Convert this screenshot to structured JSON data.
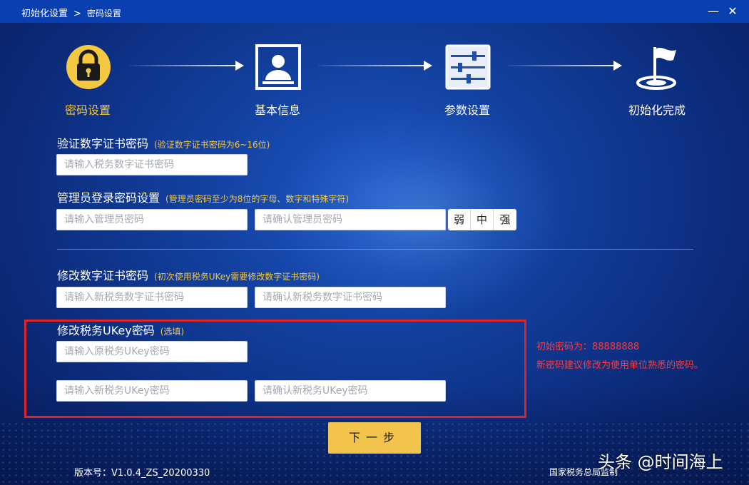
{
  "titlebar": {
    "breadcrumb_root": "初始化设置",
    "breadcrumb_sep": ">",
    "breadcrumb_current": "密码设置",
    "minimize_label": "—",
    "close_label": "✕"
  },
  "steps": [
    {
      "label": "密码设置",
      "icon": "lock-icon",
      "active": true
    },
    {
      "label": "基本信息",
      "icon": "id-card-icon",
      "active": false
    },
    {
      "label": "参数设置",
      "icon": "sliders-icon",
      "active": false
    },
    {
      "label": "初始化完成",
      "icon": "flag-icon",
      "active": false
    }
  ],
  "cert_verify": {
    "title": "验证数字证书密码",
    "hint": "(验证数字证书密码为6~16位)",
    "input_placeholder": "请输入税务数字证书密码",
    "input_value": ""
  },
  "admin_password": {
    "title": "管理员登录密码设置",
    "hint": "(管理员密码至少为8位的字母、数字和特殊字符)",
    "input_placeholder": "请输入管理员密码",
    "confirm_placeholder": "请确认管理员密码",
    "strength": [
      "弱",
      "中",
      "强"
    ]
  },
  "cert_change": {
    "title": "修改数字证书密码",
    "hint": "(初次使用税务UKey需要修改数字证书密码)",
    "new_placeholder": "请输入新税务数字证书密码",
    "confirm_placeholder": "请确认新税务数字证书密码"
  },
  "ukey_change": {
    "title": "修改税务UKey密码",
    "hint": "(选填)",
    "old_placeholder": "请输入原税务UKey密码",
    "new_placeholder": "请输入新税务UKey密码",
    "confirm_placeholder": "请确认新税务UKey密码"
  },
  "note": {
    "line1": "初始密码为：88888888",
    "line2": "新密码建议修改为使用单位熟悉的密码。"
  },
  "next_button": "下一步",
  "footer": {
    "version": "版本号：V1.0.4_ZS_20200330",
    "supervisor": "国家税务总局监制",
    "watermark": "头条 @时间海上"
  },
  "colors": {
    "accent_yellow": "#f3c44b",
    "active_step": "#f5c842",
    "warning_red": "#e02424",
    "titlebar": "#0a3fb0"
  }
}
